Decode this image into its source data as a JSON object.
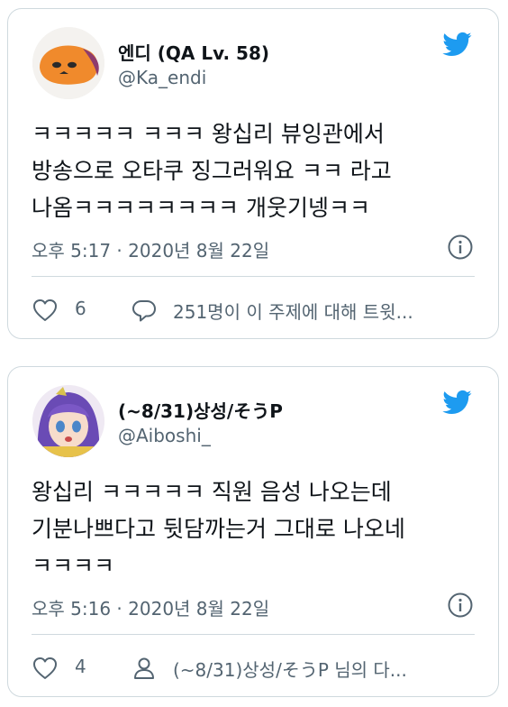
{
  "tweets": [
    {
      "author_name": "엔디 (QA Lv. 58)",
      "handle": "@Ka_endi",
      "text_lines": [
        "ㅋㅋㅋㅋㅋ ㅋㅋㅋ 왕십리 뷰잉관에서",
        "방송으로 오타쿠 징그러워요 ㅋㅋ 라고",
        "나옴ㅋㅋㅋㅋㅋㅋㅋㅋ 개웃기넹ㅋㅋ"
      ],
      "timestamp": "오후 5:17 · 2020년 8월 22일",
      "like_count": "6",
      "secondary_action": "251명이 이 주제에 대해 트윗...",
      "secondary_icon": "speech-bubble-icon"
    },
    {
      "author_name": "(~8/31)상성/そうP",
      "handle": "@Aiboshi_",
      "text_lines": [
        "왕십리 ㅋㅋㅋㅋㅋ 직원 음성 나오는데",
        "기분나쁘다고 뒷담까는거 그대로 나오네",
        "ㅋㅋㅋㅋ"
      ],
      "timestamp": "오후 5:16 · 2020년 8월 22일",
      "like_count": "4",
      "secondary_action": "(~8/31)상성/そうP 님의 다...",
      "secondary_icon": "person-icon"
    }
  ],
  "colors": {
    "twitter_blue": "#1d9bf0",
    "text_primary": "#0f1419",
    "text_secondary": "#536471",
    "border": "#cfd9de"
  }
}
